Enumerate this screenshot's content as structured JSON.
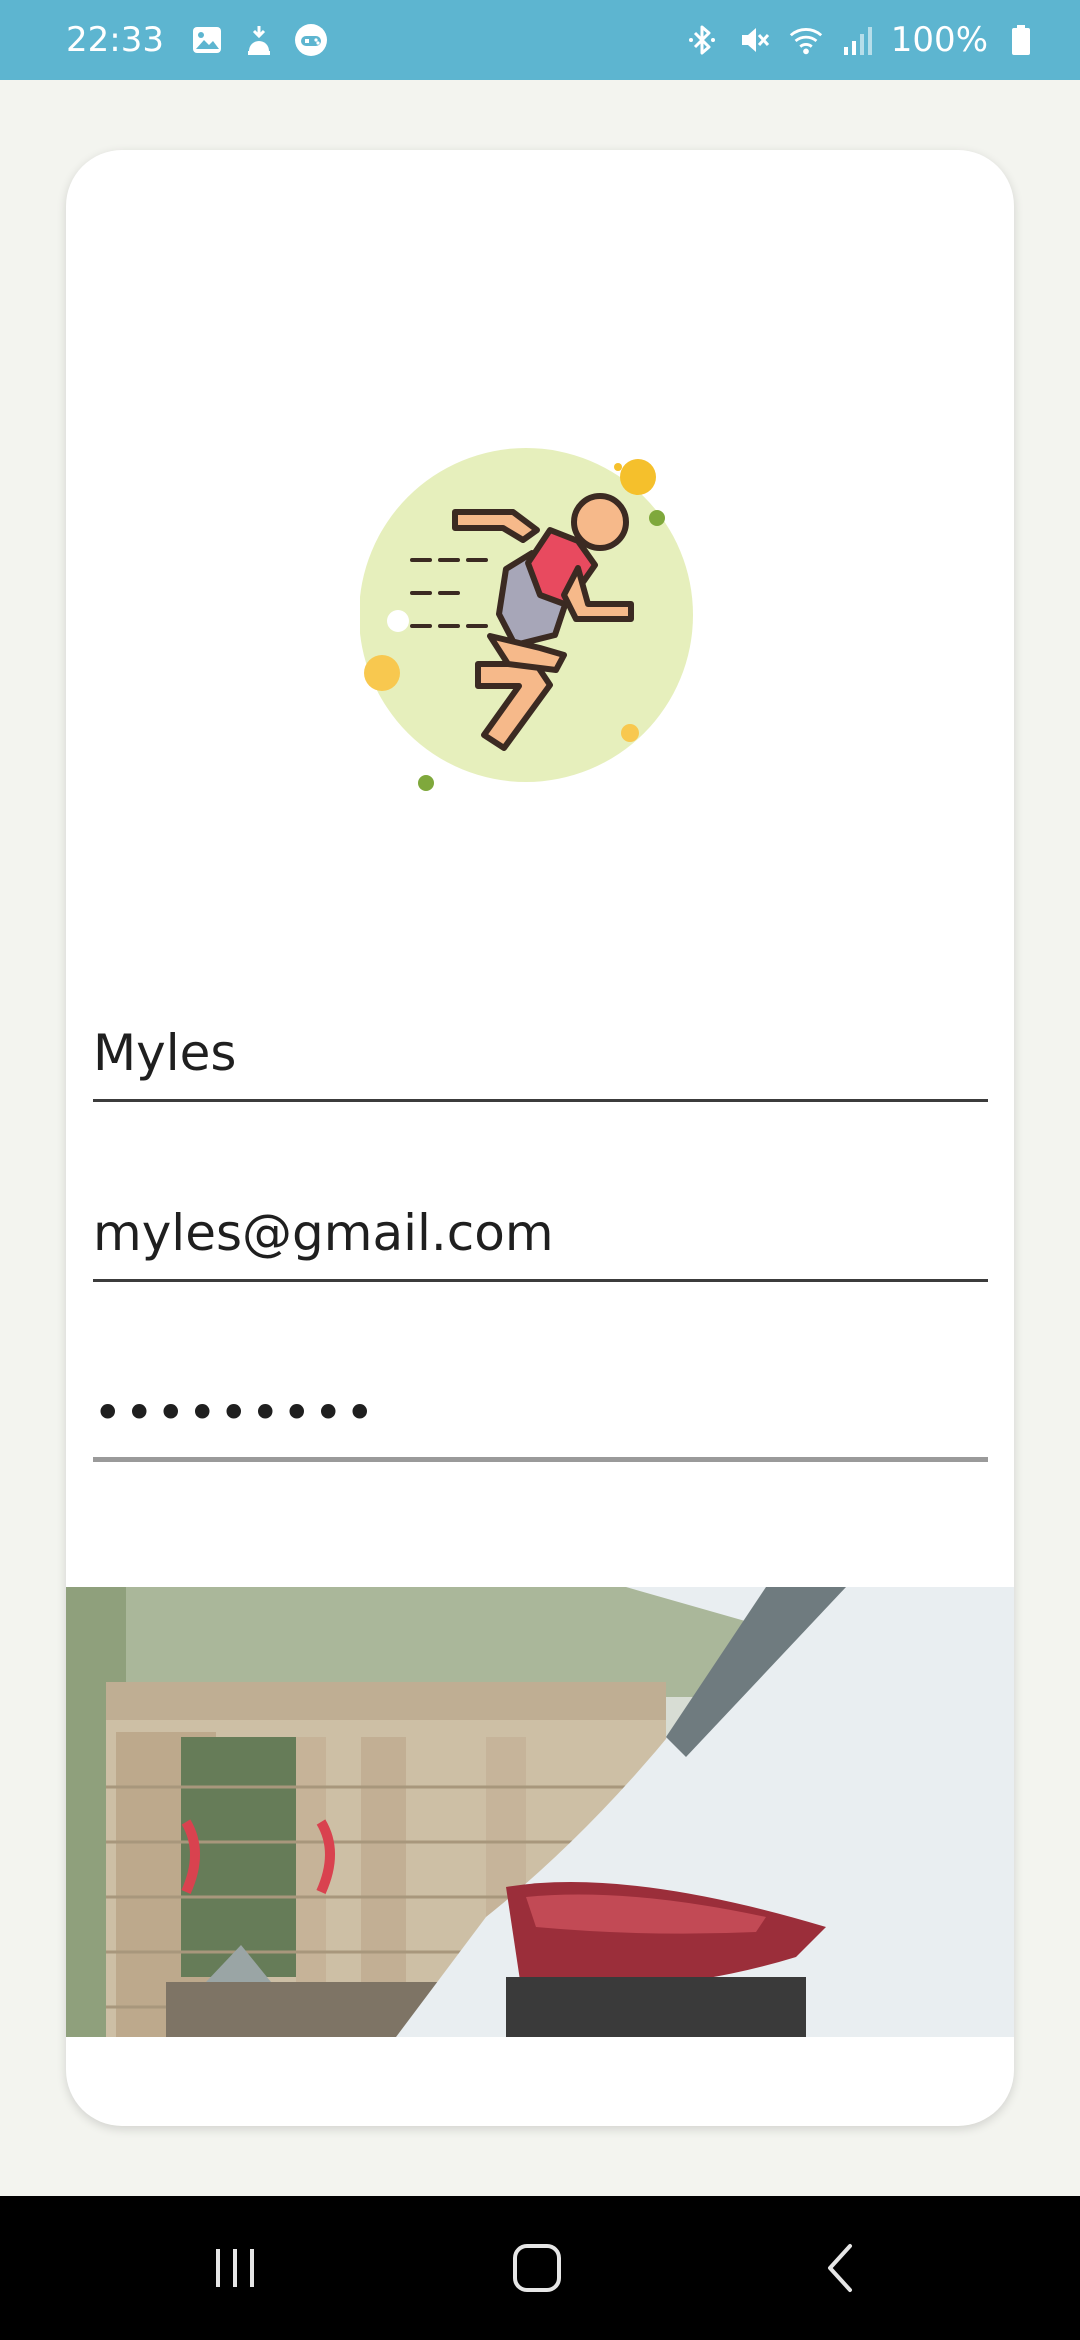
{
  "status_bar": {
    "time": "22:33",
    "battery_percent": "100%",
    "left_icons": [
      "gallery-icon",
      "android-update-icon",
      "game-controller-icon"
    ],
    "right_icons": [
      "bluetooth-icon",
      "mute-icon",
      "wifi-icon",
      "signal-icon",
      "battery-icon"
    ]
  },
  "form": {
    "name_value": "Myles",
    "email_value": "myles@gmail.com",
    "password_value": "•••••••••"
  },
  "logo": {
    "icon": "running-person-icon"
  },
  "nav_bar": {
    "buttons": [
      "recents-icon",
      "home-icon",
      "back-icon"
    ]
  },
  "colors": {
    "status_bar": "#5db5d0",
    "background": "#f3f4ef",
    "card": "#ffffff",
    "logo_circle": "#e6efbc",
    "shirt": "#e84a5f",
    "skin": "#f6b98a",
    "shorts": "#a7a6b8"
  }
}
